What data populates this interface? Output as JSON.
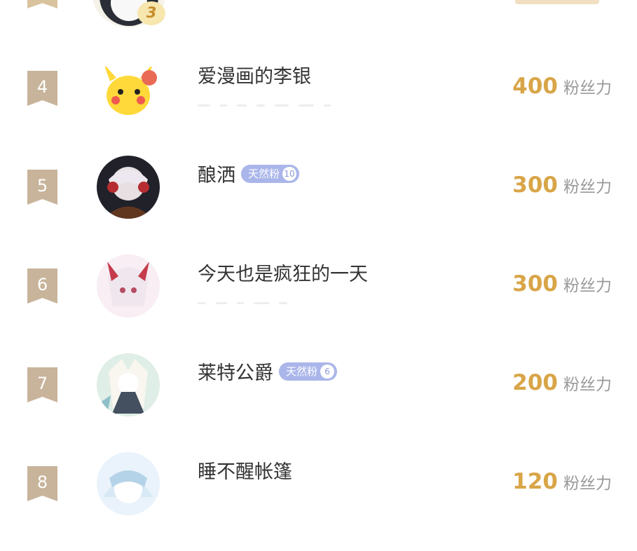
{
  "previous_entry": {
    "medal_rank": "3"
  },
  "leaderboard": [
    {
      "rank": "4",
      "name": "爱漫画的李银",
      "badge": "",
      "badge_level": "",
      "score": "400",
      "unit": "粉丝力",
      "avatar": "pikachu-avatar"
    },
    {
      "rank": "5",
      "name": "酿洒",
      "badge": "天然粉",
      "badge_level": "10",
      "score": "300",
      "unit": "粉丝力",
      "avatar": "anime-boy-avatar"
    },
    {
      "rank": "6",
      "name": "今天也是疯狂的一天",
      "badge": "",
      "badge_level": "",
      "score": "300",
      "unit": "粉丝力",
      "avatar": "anime-girl-avatar"
    },
    {
      "rank": "7",
      "name": "莱特公爵",
      "badge": "天然粉",
      "badge_level": "6",
      "score": "200",
      "unit": "粉丝力",
      "avatar": "anime-duke-avatar"
    },
    {
      "rank": "8",
      "name": "睡不醒帐篷",
      "badge": "",
      "badge_level": "",
      "score": "120",
      "unit": "粉丝力",
      "avatar": "anime-sleeper-avatar"
    }
  ],
  "colors": {
    "accent": "#d8a547",
    "rank_bg": "#c8b49b",
    "badge_bg": "#aab6ea"
  }
}
